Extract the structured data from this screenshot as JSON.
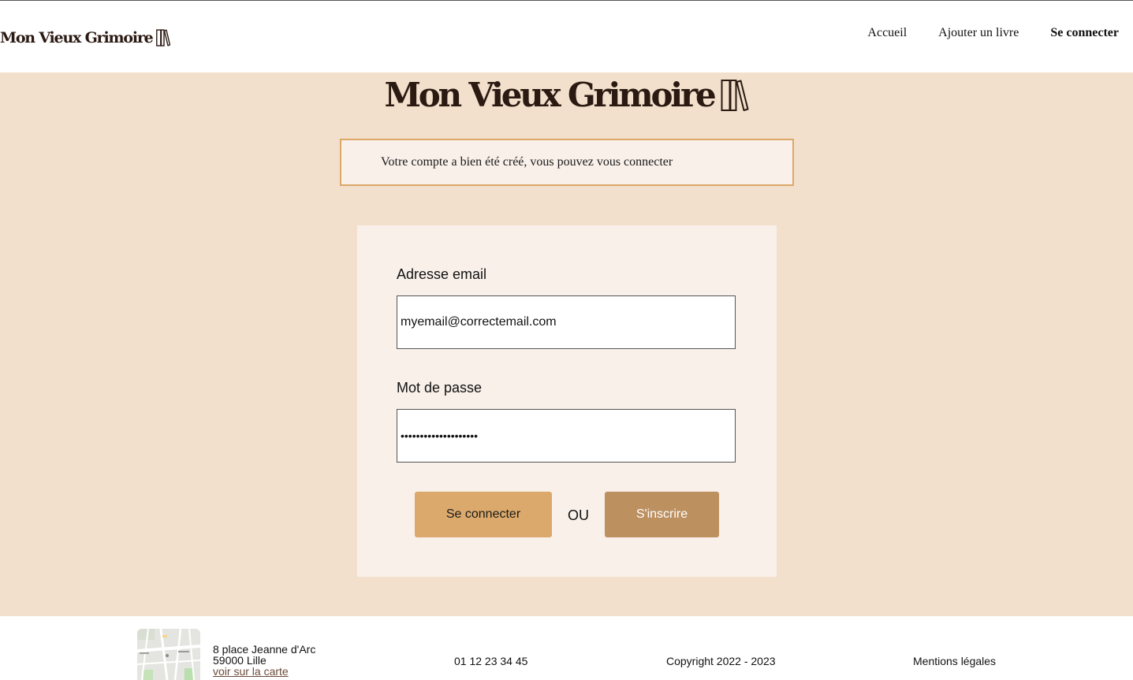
{
  "header": {
    "brand": "Mon Vieux Grimoire",
    "nav": [
      {
        "label": "Accueil"
      },
      {
        "label": "Ajouter un livre"
      },
      {
        "label": "Se connecter"
      }
    ]
  },
  "main": {
    "brand": "Mon Vieux Grimoire",
    "alert": "Votre compte a bien été créé, vous pouvez vous connecter",
    "form": {
      "email_label": "Adresse email",
      "email_value": "myemail@correctemail.com",
      "password_label": "Mot de passe",
      "password_value": "••••••••••••••••••••",
      "login_button": "Se connecter",
      "or": "OU",
      "signup_button": "S'inscrire"
    }
  },
  "footer": {
    "address_line1": "8 place Jeanne d'Arc",
    "address_line2": "59000 Lille",
    "map_link": "voir sur la carte",
    "phone": "01 12 23 34 45",
    "copyright": "Copyright 2022 - 2023",
    "legal": "Mentions légales"
  },
  "colors": {
    "main_bg": "#f2e0cc",
    "card_bg": "#f9f0ea",
    "alert_border": "#dca768",
    "login_button": "#dca96c",
    "signup_button": "#bd9060",
    "brand_text": "#2b1a12"
  },
  "icons": {
    "logo": "books-logo-icon",
    "map": "map-thumbnail"
  }
}
